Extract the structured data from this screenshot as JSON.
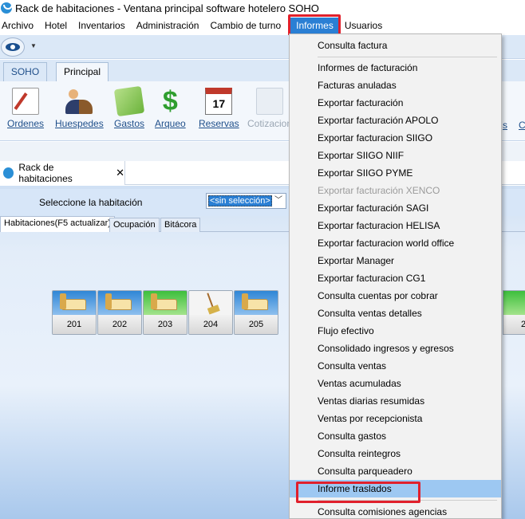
{
  "window": {
    "title": "Rack de habitaciones  - Ventana principal software hotelero SOHO"
  },
  "menubar": {
    "items": [
      "Archivo",
      "Hotel",
      "Inventarios",
      "Administración",
      "Cambio de turno",
      "Informes",
      "Usuarios"
    ],
    "active": "Informes"
  },
  "ribbon": {
    "tabs": [
      "SOHO",
      "Principal"
    ],
    "active_tab": "Principal",
    "buttons": [
      "Ordenes",
      "Huespedes",
      "Gastos",
      "Arqueo",
      "Reservas",
      "Cotizacion"
    ],
    "partial_right": [
      "s",
      "C"
    ],
    "reservas_icon_text": "17"
  },
  "document_tab": {
    "label": "Rack de habitaciones",
    "close": "✕"
  },
  "selector": {
    "label": "Seleccione la habitación",
    "value": "<sin selección>"
  },
  "subtabs": [
    "Habitaciones(F5 actualizar)",
    "Ocupación",
    "Bitácora"
  ],
  "rooms": [
    {
      "number": "201",
      "status": "blue"
    },
    {
      "number": "202",
      "status": "blue"
    },
    {
      "number": "203",
      "status": "green"
    },
    {
      "number": "204",
      "status": "cleaning"
    },
    {
      "number": "205",
      "status": "blue"
    }
  ],
  "room_partial": "2",
  "informes_menu": {
    "items": [
      "Consulta factura",
      "Informes de facturación",
      "Facturas anuladas",
      "Exportar facturación",
      "Exportar facturación APOLO",
      "Exportar facturacion SIIGO",
      "Exportar SIIGO NIIF",
      "Exportar SIIGO PYME",
      "Exportar facturación XENCO",
      "Exportar facturación SAGI",
      "Exportar facturacion HELISA",
      "Exportar facturacion  world office",
      "Exportar Manager",
      "Exportar facturacion CG1",
      "Consulta cuentas por cobrar",
      "Consulta ventas detalles",
      "Flujo efectivo",
      "Consolidado ingresos y egresos",
      "Consulta ventas",
      "Ventas acumuladas",
      "Ventas diarias resumidas",
      "Ventas por recepcionista",
      "Consulta gastos",
      "Consulta reintegros",
      "Consulta parqueadero",
      "Informe traslados",
      "Consulta comisiones agencias"
    ],
    "disabled": [
      "Exportar facturación XENCO"
    ],
    "hovered": "Informe traslados"
  },
  "colors": {
    "highlight_red": "#e0202c",
    "menu_active": "#2a7fd4",
    "menu_hover": "#9dc8f2"
  }
}
